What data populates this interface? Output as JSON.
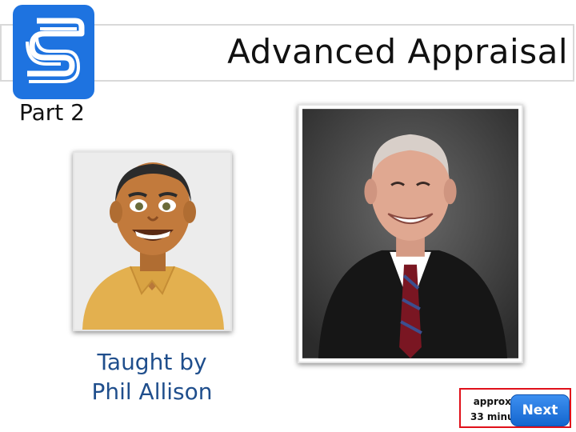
{
  "header": {
    "title": "Advanced Appraisal",
    "subtitle": "Part 2"
  },
  "logo": {
    "icon": "stylized-s-logo-icon",
    "color": "#1e73e0"
  },
  "instructor": {
    "taught_by_line1": "Taught by",
    "taught_by_line2": "Phil Allison",
    "avatar_icon": "cartoon-avatar-icon",
    "photo_icon": "instructor-photo"
  },
  "footer": {
    "approx_line1": "approx",
    "approx_line2": "33 minu",
    "next_label": "Next",
    "accent": "#e0101a",
    "button_color": "#1e73e0"
  }
}
